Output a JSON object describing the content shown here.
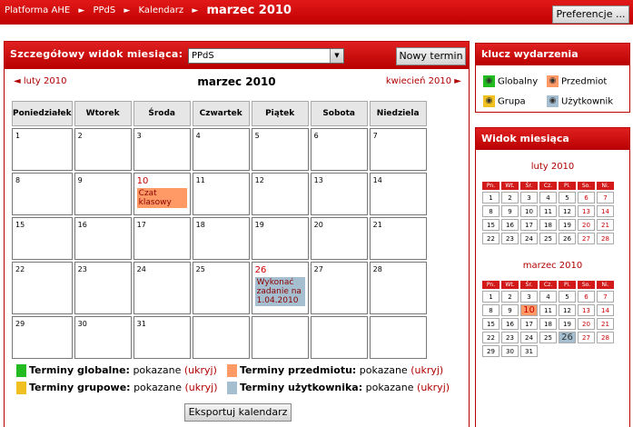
{
  "breadcrumb": {
    "home": "Platforma AHE",
    "course": "PPdS",
    "section": "Kalendarz",
    "current": "marzec 2010"
  },
  "header": {
    "preferences_label": "Preferencje ..."
  },
  "main": {
    "title": "Szczegółowy widok miesiąca:",
    "course_select": "PPdS",
    "new_event_label": "Nowy termin",
    "prev_month": "◄ luty 2010",
    "current_month": "marzec 2010",
    "next_month": "kwiecień 2010 ►",
    "weekdays": [
      "Poniedziałek",
      "Wtorek",
      "Środa",
      "Czwartek",
      "Piątek",
      "Sobota",
      "Niedziela"
    ],
    "weeks": [
      [
        "1",
        "2",
        "3",
        "4",
        "5",
        "6",
        "7"
      ],
      [
        "8",
        "9",
        "10",
        "11",
        "12",
        "13",
        "14"
      ],
      [
        "15",
        "16",
        "17",
        "18",
        "19",
        "20",
        "21"
      ],
      [
        "22",
        "23",
        "24",
        "25",
        "26",
        "27",
        "28"
      ],
      [
        "29",
        "30",
        "31",
        "",
        "",
        "",
        ""
      ]
    ],
    "events": [
      {
        "day": "10",
        "title": "Czat klasowy",
        "type": "course"
      },
      {
        "day": "26",
        "title": "Wykonać zadanie na 1.04.2010",
        "type": "user"
      }
    ],
    "today_days": [
      "10",
      "26"
    ],
    "export_label": "Eksportuj kalendarz"
  },
  "legend": {
    "global": {
      "label": "Terminy globalne:",
      "state": " pokazane",
      "link": "(ukryj)",
      "color": "#22bb22"
    },
    "course": {
      "label": "Terminy przedmiotu:",
      "state": " pokazane",
      "link": "(ukryj)",
      "color": "#ff9966"
    },
    "group": {
      "label": "Terminy grupowe:",
      "state": " pokazane",
      "link": "(ukryj)",
      "color": "#f0c020"
    },
    "user": {
      "label": "Terminy użytkownika:",
      "state": " pokazane",
      "link": "(ukryj)",
      "color": "#a6bfd0"
    }
  },
  "event_key": {
    "title": "klucz wydarzenia",
    "items": [
      {
        "label": "Globalny",
        "color": "#22bb22",
        "icon": "eye-icon"
      },
      {
        "label": "Przedmiot",
        "color": "#ff9966",
        "icon": "eye-icon"
      },
      {
        "label": "Grupa",
        "color": "#f0c020",
        "icon": "eye-icon"
      },
      {
        "label": "Użytkownik",
        "color": "#a6bfd0",
        "icon": "eye-icon"
      }
    ]
  },
  "month_view": {
    "title": "Widok miesiąca",
    "weekday_abbr": [
      "Pn.",
      "Wt.",
      "Śr.",
      "Cz.",
      "Pi.",
      "So.",
      "Ni."
    ],
    "feb": {
      "title": "luty 2010",
      "weeks": [
        [
          "1",
          "2",
          "3",
          "4",
          "5",
          "6",
          "7"
        ],
        [
          "8",
          "9",
          "10",
          "11",
          "12",
          "13",
          "14"
        ],
        [
          "15",
          "16",
          "17",
          "18",
          "19",
          "20",
          "21"
        ],
        [
          "22",
          "23",
          "24",
          "25",
          "26",
          "27",
          "28"
        ]
      ]
    },
    "mar": {
      "title": "marzec 2010",
      "weeks": [
        [
          "1",
          "2",
          "3",
          "4",
          "5",
          "6",
          "7"
        ],
        [
          "8",
          "9",
          "10",
          "11",
          "12",
          "13",
          "14"
        ],
        [
          "15",
          "16",
          "17",
          "18",
          "19",
          "20",
          "21"
        ],
        [
          "22",
          "23",
          "24",
          "25",
          "26",
          "27",
          "28"
        ],
        [
          "29",
          "30",
          "31",
          "",
          "",
          "",
          ""
        ]
      ],
      "course_days": [
        "10"
      ],
      "user_days": [
        "26"
      ]
    }
  }
}
